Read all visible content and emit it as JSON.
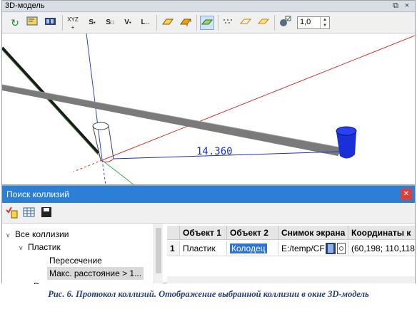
{
  "window3d": {
    "title": "3D-модель",
    "dim_label": "14.360",
    "zoom_value": "1,0",
    "toolbar": {
      "btn_xyz": "XYZ",
      "btn_s": "S",
      "btn_s_sub": "o",
      "btn_s2": "S",
      "btn_v": "V",
      "btn_l": "L"
    }
  },
  "collision": {
    "title": "Поиск коллизий",
    "tree": [
      {
        "label": "Все коллизии",
        "expand": "v"
      },
      {
        "label": "Пластик",
        "expand": "v"
      },
      {
        "label": "Пересечение",
        "expand": ""
      },
      {
        "label": "Макс. расстояние > 1...",
        "expand": ""
      },
      {
        "label": "Р",
        "expand": ""
      }
    ],
    "columns": [
      "",
      "Объект 1",
      "Объект 2",
      "Снимок экрана",
      "Координаты к"
    ],
    "rows": [
      {
        "num": "1",
        "obj1": "Пластик",
        "obj2": "Колодец",
        "snapshot": "E:/temp/CF",
        "coords": "(60,198; 110,118"
      }
    ]
  },
  "caption": "Рис. 6. Протокол коллизий. Отображение выбранной коллизии в окне 3D-модель",
  "colors": {
    "accent": "#2b7fd6",
    "selection": "#2f73d0",
    "axis_red": "#d8322b",
    "axis_blue": "#2a45d8",
    "pipe": "#7a7a7a"
  }
}
